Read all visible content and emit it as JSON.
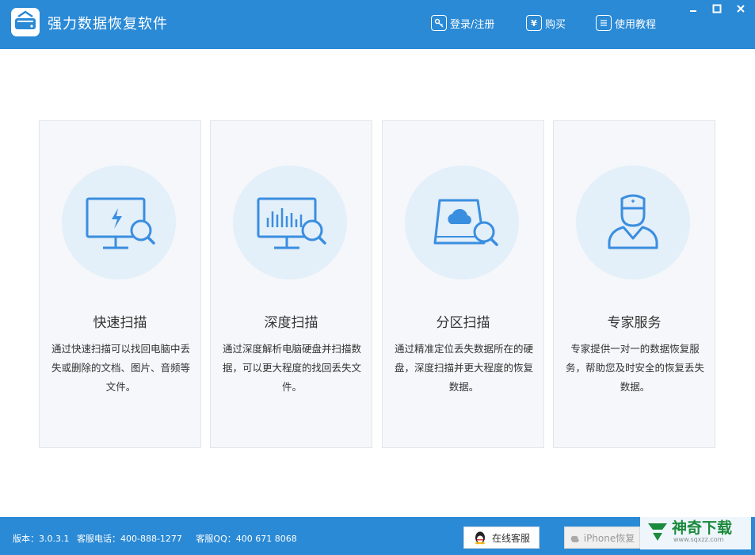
{
  "app": {
    "title": "强力数据恢复软件"
  },
  "header": {
    "login_label": "登录/注册",
    "buy_label": "购买",
    "tutorial_label": "使用教程"
  },
  "window_controls": {
    "minimize": "—",
    "maximize": "□",
    "close": "✕"
  },
  "cards": [
    {
      "title": "快速扫描",
      "desc": "通过快速扫描可以找回电脑中丢失或删除的文档、图片、音频等文件。",
      "icon": "monitor-lightning-search-icon"
    },
    {
      "title": "深度扫描",
      "desc": "通过深度解析电脑硬盘并扫描数据，可以更大程度的找回丢失文件。",
      "icon": "monitor-chart-search-icon"
    },
    {
      "title": "分区扫描",
      "desc": "通过精准定位丢失数据所在的硬盘，深度扫描并更大程度的恢复数据。",
      "icon": "disk-cloud-search-icon"
    },
    {
      "title": "专家服务",
      "desc": "专家提供一对一的数据恢复服务，帮助您及时安全的恢复丢失数据。",
      "icon": "doctor-icon"
    }
  ],
  "footer": {
    "version": "版本：3.0.3.1",
    "phone": "客服电话：400-888-1277",
    "qq": "客服QQ：400 671 8068",
    "online_service_label": "在线客服",
    "iphone_label": "iPhone恢复"
  },
  "watermark": {
    "main": "神奇下载",
    "sub": "www.sqxzz.com"
  },
  "colors": {
    "primary": "#2a8ad6",
    "icon_blue": "#3a8ee0",
    "card_bg": "#f5f7fa",
    "circle_bg": "#e3eff9"
  }
}
